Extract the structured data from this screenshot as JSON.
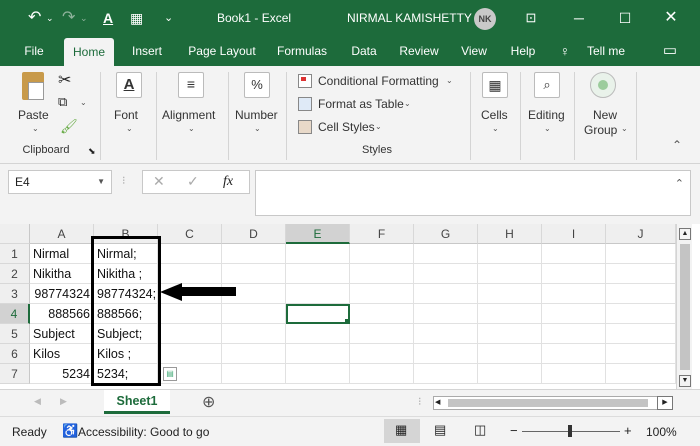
{
  "titlebar": {
    "undo_icon": "undo-icon",
    "redo_icon": "redo-icon",
    "doc_title": "Book1 - Excel",
    "user_name": "NIRMAL KAMISHETTY",
    "user_initials": "NK",
    "accent": "#1d6b3b"
  },
  "tabs": {
    "file": "File",
    "home": "Home",
    "insert": "Insert",
    "page_layout": "Page Layout",
    "formulas": "Formulas",
    "data": "Data",
    "review": "Review",
    "view": "View",
    "help": "Help",
    "tell_me": "Tell me"
  },
  "ribbon": {
    "paste": "Paste",
    "clipboard": "Clipboard",
    "font": "Font",
    "alignment": "Alignment",
    "number": "Number",
    "conditional_formatting": "Conditional Formatting",
    "format_as_table": "Format as Table",
    "cell_styles": "Cell Styles",
    "styles": "Styles",
    "cells": "Cells",
    "editing": "Editing",
    "new_group_line1": "New",
    "new_group_line2": "Group"
  },
  "formula_bar": {
    "name_box": "E4",
    "fx": "fx",
    "formula": ""
  },
  "grid": {
    "columns": [
      "A",
      "B",
      "C",
      "D",
      "E",
      "F",
      "G",
      "H",
      "I",
      "J"
    ],
    "rows": [
      "1",
      "2",
      "3",
      "4",
      "5",
      "6",
      "7"
    ],
    "selected_cell": "E4",
    "col_a": [
      "Nirmal",
      "Nikitha",
      "98774324",
      "888566",
      "Subject",
      "Kilos",
      "5234"
    ],
    "col_b": [
      "Nirmal;",
      "Nikitha ;",
      "98774324;",
      "888566;",
      "Subject;",
      "Kilos ;",
      "5234;"
    ]
  },
  "sheets": {
    "active": "Sheet1"
  },
  "status": {
    "ready": "Ready",
    "accessibility": "Accessibility: Good to go",
    "zoom": "100%"
  }
}
